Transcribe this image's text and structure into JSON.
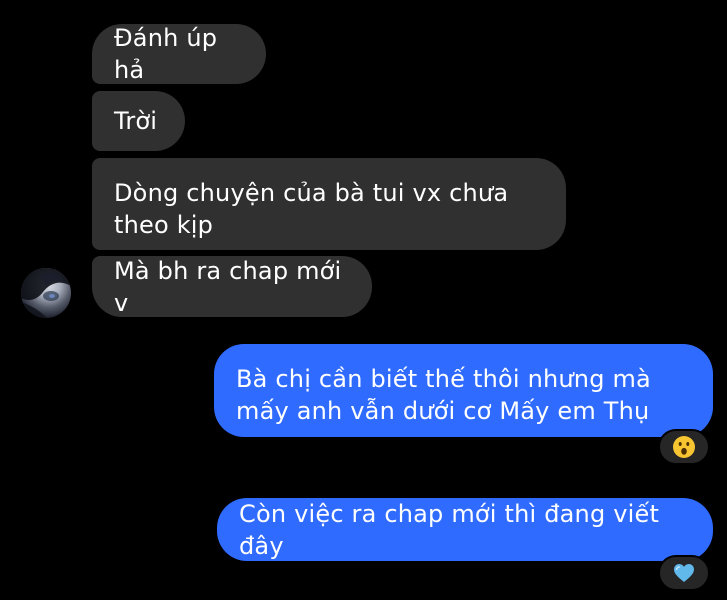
{
  "conversation": {
    "incoming_messages": [
      {
        "text": "Đánh úp hả"
      },
      {
        "text": "Trời"
      },
      {
        "text": "Dòng chuyện của bà tui vx chưa theo kịp"
      },
      {
        "text": "Mà bh ra chap mới v"
      }
    ],
    "outgoing_messages": [
      {
        "text": "Bà chị cần biết thế thôi nhưng mà mấy anh vẫn dưới cơ Mấy em Thụ",
        "reaction": "😮"
      },
      {
        "text": "Còn việc ra chap mới thì đang viết đây",
        "reaction": "💙"
      }
    ]
  },
  "colors": {
    "background": "#000000",
    "incoming_bubble": "#303030",
    "outgoing_bubble": "#2f6bff",
    "reaction_pill": "#262626"
  },
  "icons": {
    "avatar": "contact-avatar",
    "reaction_1": "surprised-face-icon",
    "reaction_2": "blue-heart-icon"
  }
}
